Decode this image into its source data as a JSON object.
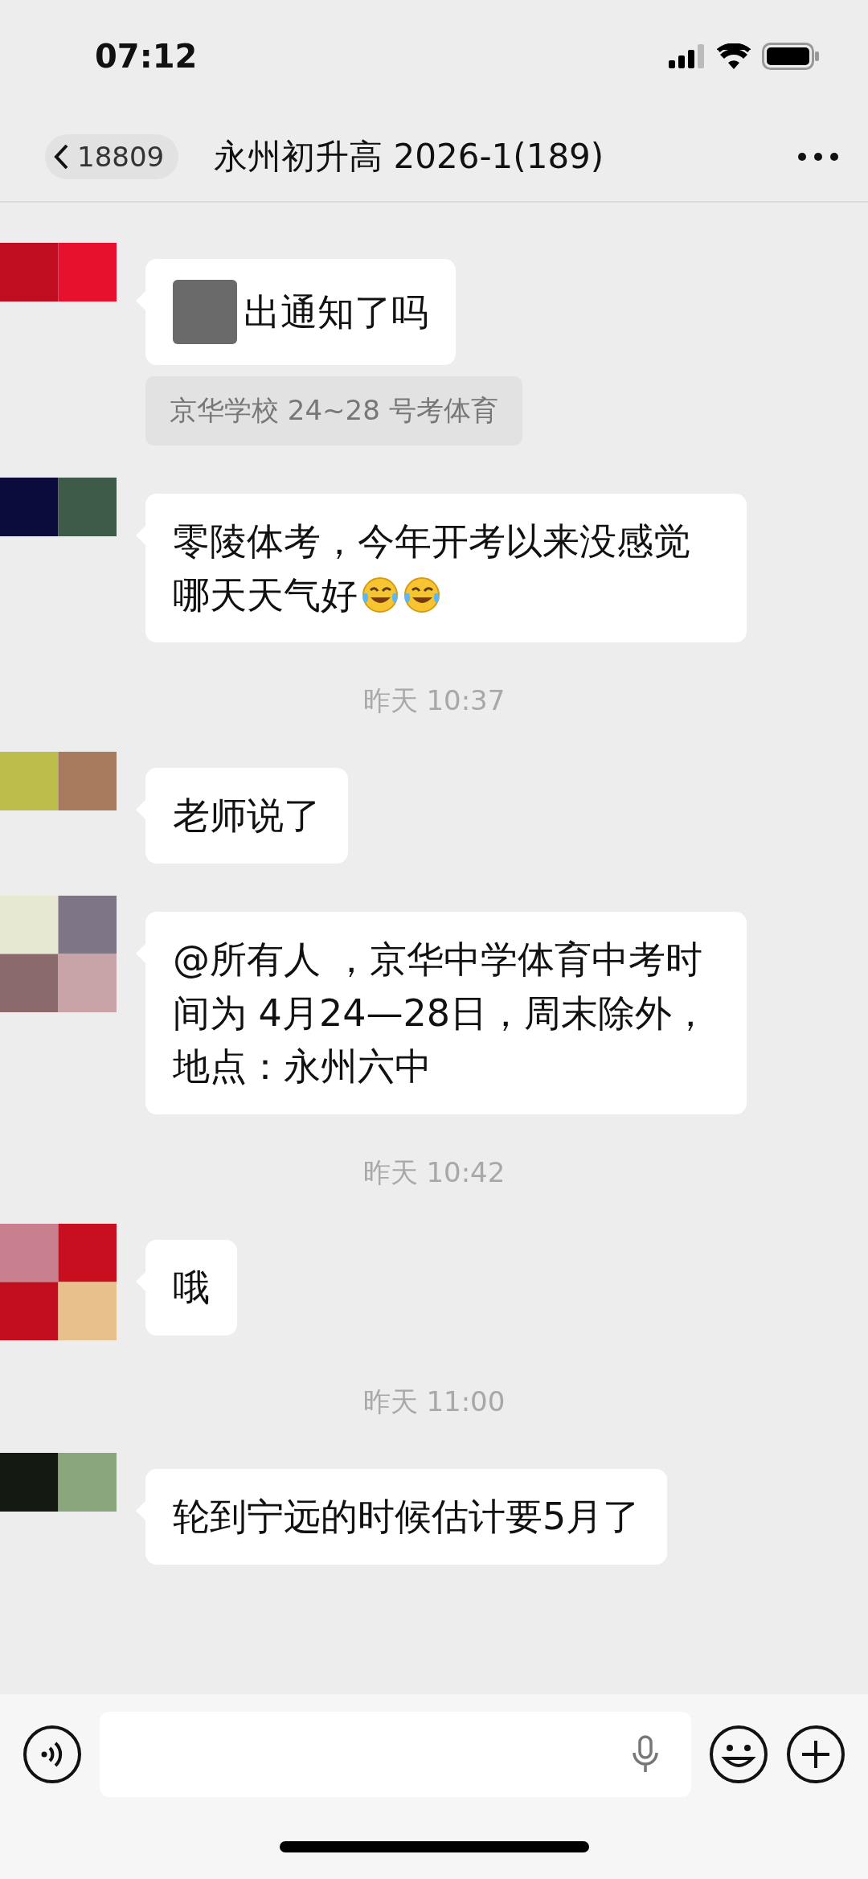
{
  "status_bar": {
    "time": "07:12"
  },
  "header": {
    "back_label": "18809",
    "title": "永州初升高 2026-1(189)"
  },
  "messages": [
    {
      "kind": "message",
      "text": "出通知了吗",
      "redacted": true,
      "quote": "京华学校 24~28 号考体育"
    },
    {
      "kind": "message",
      "text": "零陵体考，今年开考以来没感觉哪天天气好",
      "redacted": false,
      "emojis": [
        {
          "kind": "laugh-cry"
        },
        {
          "kind": "laugh-cry"
        }
      ]
    },
    {
      "kind": "time",
      "text": "昨天 10:37"
    },
    {
      "kind": "message",
      "text": "老师说了",
      "redacted": false
    },
    {
      "kind": "message",
      "text": "@所有人 ，京华中学体育中考时间为 4月24—28日，周末除外，地点：永州六中",
      "redacted": false
    },
    {
      "kind": "time",
      "text": "昨天 10:42"
    },
    {
      "kind": "message",
      "text": "哦",
      "redacted": false
    },
    {
      "kind": "time",
      "text": "昨天 11:00"
    },
    {
      "kind": "message",
      "text": "轮到宁远的时候估计要5月了",
      "redacted": false
    }
  ]
}
